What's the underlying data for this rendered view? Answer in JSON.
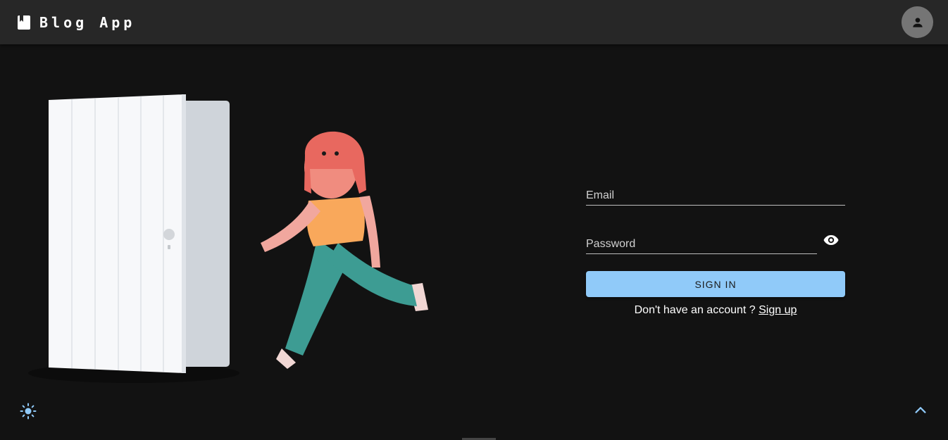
{
  "header": {
    "title": "Blog App",
    "brand_icon": "book-icon",
    "avatar_icon": "person-icon"
  },
  "login": {
    "email_placeholder": "Email",
    "email_value": "",
    "password_placeholder": "Password",
    "password_value": "",
    "visibility_icon": "eye-icon",
    "sign_in_label": "SIGN IN",
    "signup_prompt": "Don't have an account ? ",
    "signup_link": "Sign up"
  },
  "footer": {
    "theme_icon": "sun-icon",
    "scroll_icon": "chevron-up-icon"
  },
  "colors": {
    "background": "#121212",
    "appbar": "#272727",
    "primary": "#90caf9",
    "avatar": "#757575"
  }
}
